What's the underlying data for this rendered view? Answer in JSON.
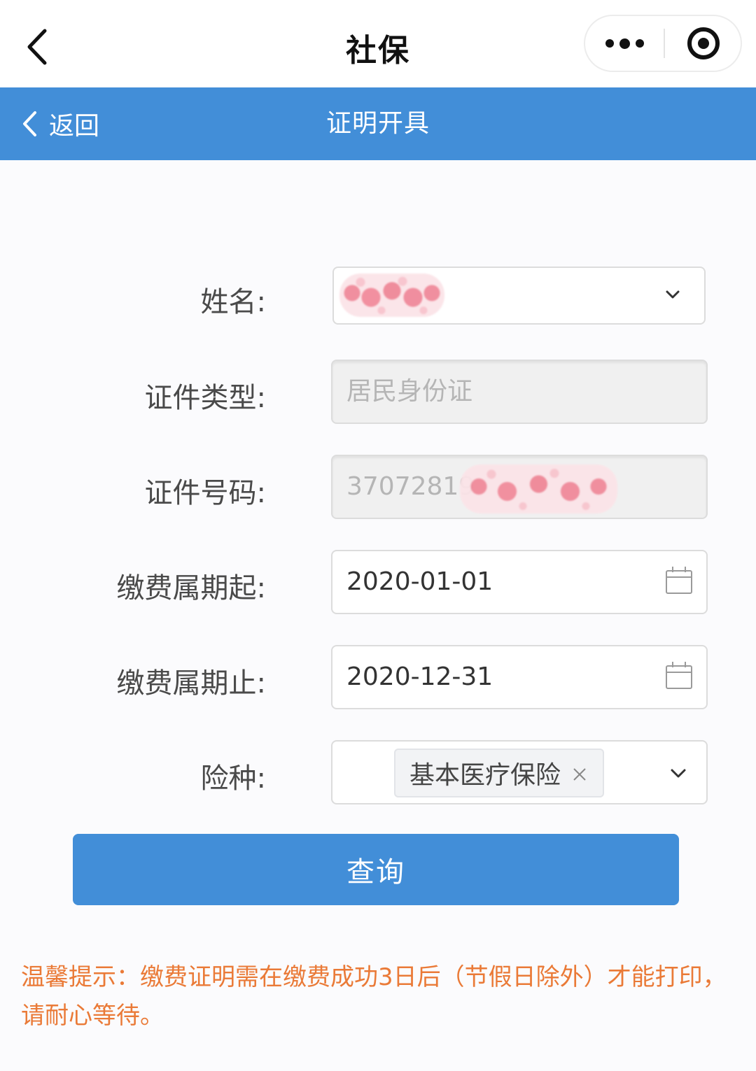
{
  "topbar": {
    "title": "社保",
    "back_icon": "chevron-left-icon",
    "more_icon": "more-dots-icon",
    "close_icon": "target-icon"
  },
  "header": {
    "back_label": "返回",
    "title": "证明开具",
    "color": "#428ed8"
  },
  "form": {
    "name": {
      "label": "姓名:",
      "value_redacted": true
    },
    "id_type": {
      "label": "证件类型:",
      "value": "居民身份证"
    },
    "id_number": {
      "label": "证件号码:",
      "value_prefix": "37072819",
      "value_redacted": true
    },
    "period_start": {
      "label": "缴费属期起:",
      "value": "2020-01-01",
      "icon": "calendar-icon"
    },
    "period_end": {
      "label": "缴费属期止:",
      "value": "2020-12-31",
      "icon": "calendar-icon"
    },
    "insurance_type": {
      "label": "险种:",
      "selected_tag": "基本医疗保险"
    }
  },
  "query_button": {
    "label": "查询"
  },
  "tip": {
    "text": "温馨提示：缴费证明需在缴费成功3日后（节假日除外）才能打印，请耐心等待。",
    "color": "#ea7a37"
  }
}
